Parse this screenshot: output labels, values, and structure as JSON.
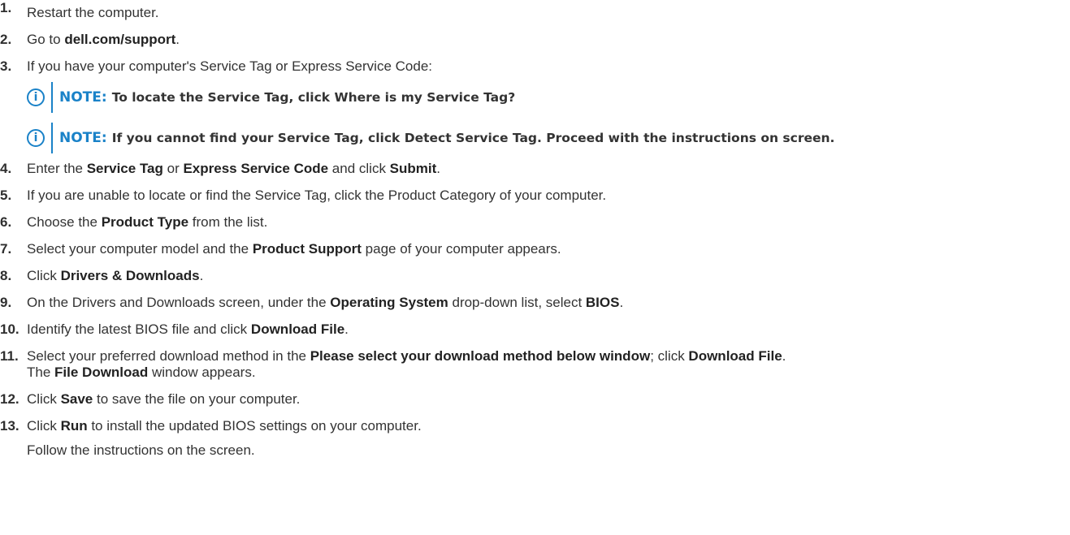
{
  "steps": [
    {
      "num": "1.",
      "text": "Restart the computer."
    },
    {
      "num": "2.",
      "pre": "Go to ",
      "bold": "dell.com/support",
      "post": "."
    },
    {
      "num": "3.",
      "text": "If you have your computer's Service Tag or Express Service Code:"
    },
    {
      "num": "4.",
      "a": "Enter the ",
      "b1": "Service Tag",
      "c": " or ",
      "b2": "Express Service Code",
      "d": " and click ",
      "b3": "Submit",
      "e": "."
    },
    {
      "num": "5.",
      "text": "If you are unable to locate or find the Service Tag, click the Product Category of your computer."
    },
    {
      "num": "6.",
      "pre": "Choose the ",
      "bold": "Product Type",
      "post": " from the list."
    },
    {
      "num": "7.",
      "pre": "Select your computer model and the ",
      "bold": "Product Support",
      "post": " page of your computer appears."
    },
    {
      "num": "8.",
      "pre": "Click ",
      "bold": "Drivers & Downloads",
      "post": "."
    },
    {
      "num": "9.",
      "a": "On the Drivers and Downloads screen, under the ",
      "b1": "Operating System",
      "c": " drop-down list, select ",
      "b2": "BIOS",
      "d": "."
    },
    {
      "num": "10.",
      "pre": "Identify the latest BIOS file and click ",
      "bold": "Download File",
      "post": "."
    },
    {
      "num": "11.",
      "a": "Select your preferred download method in the ",
      "b1": "Please select your download method below window",
      "c": "; click ",
      "b2": "Download File",
      "d": ".",
      "line2_pre": "The ",
      "line2_bold": "File Download",
      "line2_post": " window appears."
    },
    {
      "num": "12.",
      "pre": "Click ",
      "bold": "Save",
      "post": " to save the file on your computer."
    },
    {
      "num": "13.",
      "pre": "Click ",
      "bold": "Run",
      "post": " to install the updated BIOS settings on your computer.",
      "sub": "Follow the instructions on the screen."
    }
  ],
  "notes": [
    {
      "icon": "info-icon",
      "glyph": "i",
      "label": "NOTE:",
      "text": "To locate the Service Tag, click Where is my Service Tag?"
    },
    {
      "icon": "info-icon",
      "glyph": "i",
      "label": "NOTE:",
      "text": "If you cannot find your Service Tag, click Detect Service Tag. Proceed with the instructions on screen."
    }
  ],
  "colors": {
    "accent": "#1a82c8",
    "text": "#333333"
  }
}
